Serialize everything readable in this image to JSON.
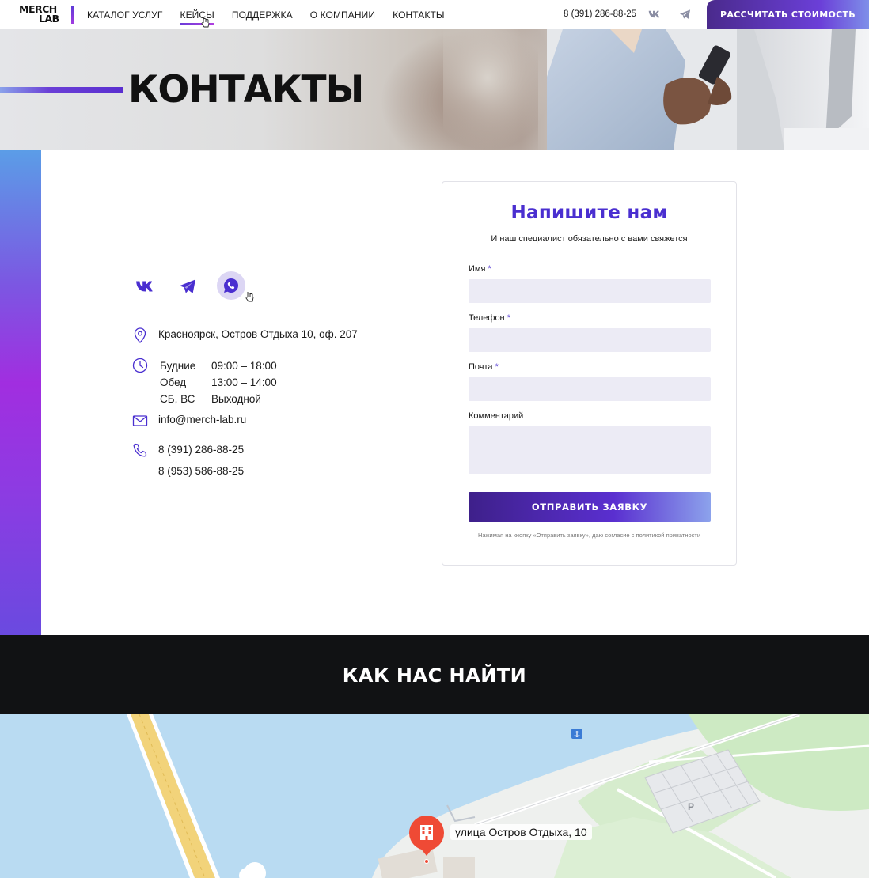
{
  "header": {
    "logo_line1": "MERCH",
    "logo_line2": "LAB",
    "nav": [
      "КАТАЛОГ УСЛУГ",
      "КЕЙСЫ",
      "ПОДДЕРЖКА",
      "О КОМПАНИИ",
      "КОНТАКТЫ"
    ],
    "active_nav": "КЕЙСЫ",
    "phone": "8 (391) 286-88-25",
    "cta_label": "РАССЧИТАТЬ СТОИМОСТЬ"
  },
  "hero": {
    "title": "КОНТАКТЫ"
  },
  "contacts": {
    "address": "Красноярск, Остров Отдыха 10, оф. 207",
    "hours": [
      {
        "day": "Будние",
        "time": "09:00 – 18:00"
      },
      {
        "day": "Обед",
        "time": "13:00 – 14:00"
      },
      {
        "day": "СБ, ВС",
        "time": "Выходной"
      }
    ],
    "email": "info@merch-lab.ru",
    "phone1": "8 (391) 286-88-25",
    "phone2": "8 (953) 586-88-25"
  },
  "form": {
    "title": "Напишите нам",
    "subtitle": "И наш специалист обязательно с вами свяжется",
    "name_label": "Имя",
    "phone_label": "Телефон",
    "email_label": "Почта",
    "comment_label": "Комментарий",
    "required_mark": "*",
    "name_value": "",
    "phone_value": "",
    "email_value": "",
    "comment_value": "",
    "submit_label": "ОТПРАВИТЬ ЗАЯВКУ",
    "consent_text": "Нажимая на кнопку «Отправить заявку», даю согласие с ",
    "consent_link": "политикой приватности"
  },
  "find": {
    "title": "КАК НАС НАЙТИ"
  },
  "map": {
    "marker_label": "улица Остров Отдыха, 10",
    "parking_label": "P"
  },
  "colors": {
    "accent": "#4a2fd0",
    "dark": "#111214",
    "input_bg": "#ecebf5"
  }
}
